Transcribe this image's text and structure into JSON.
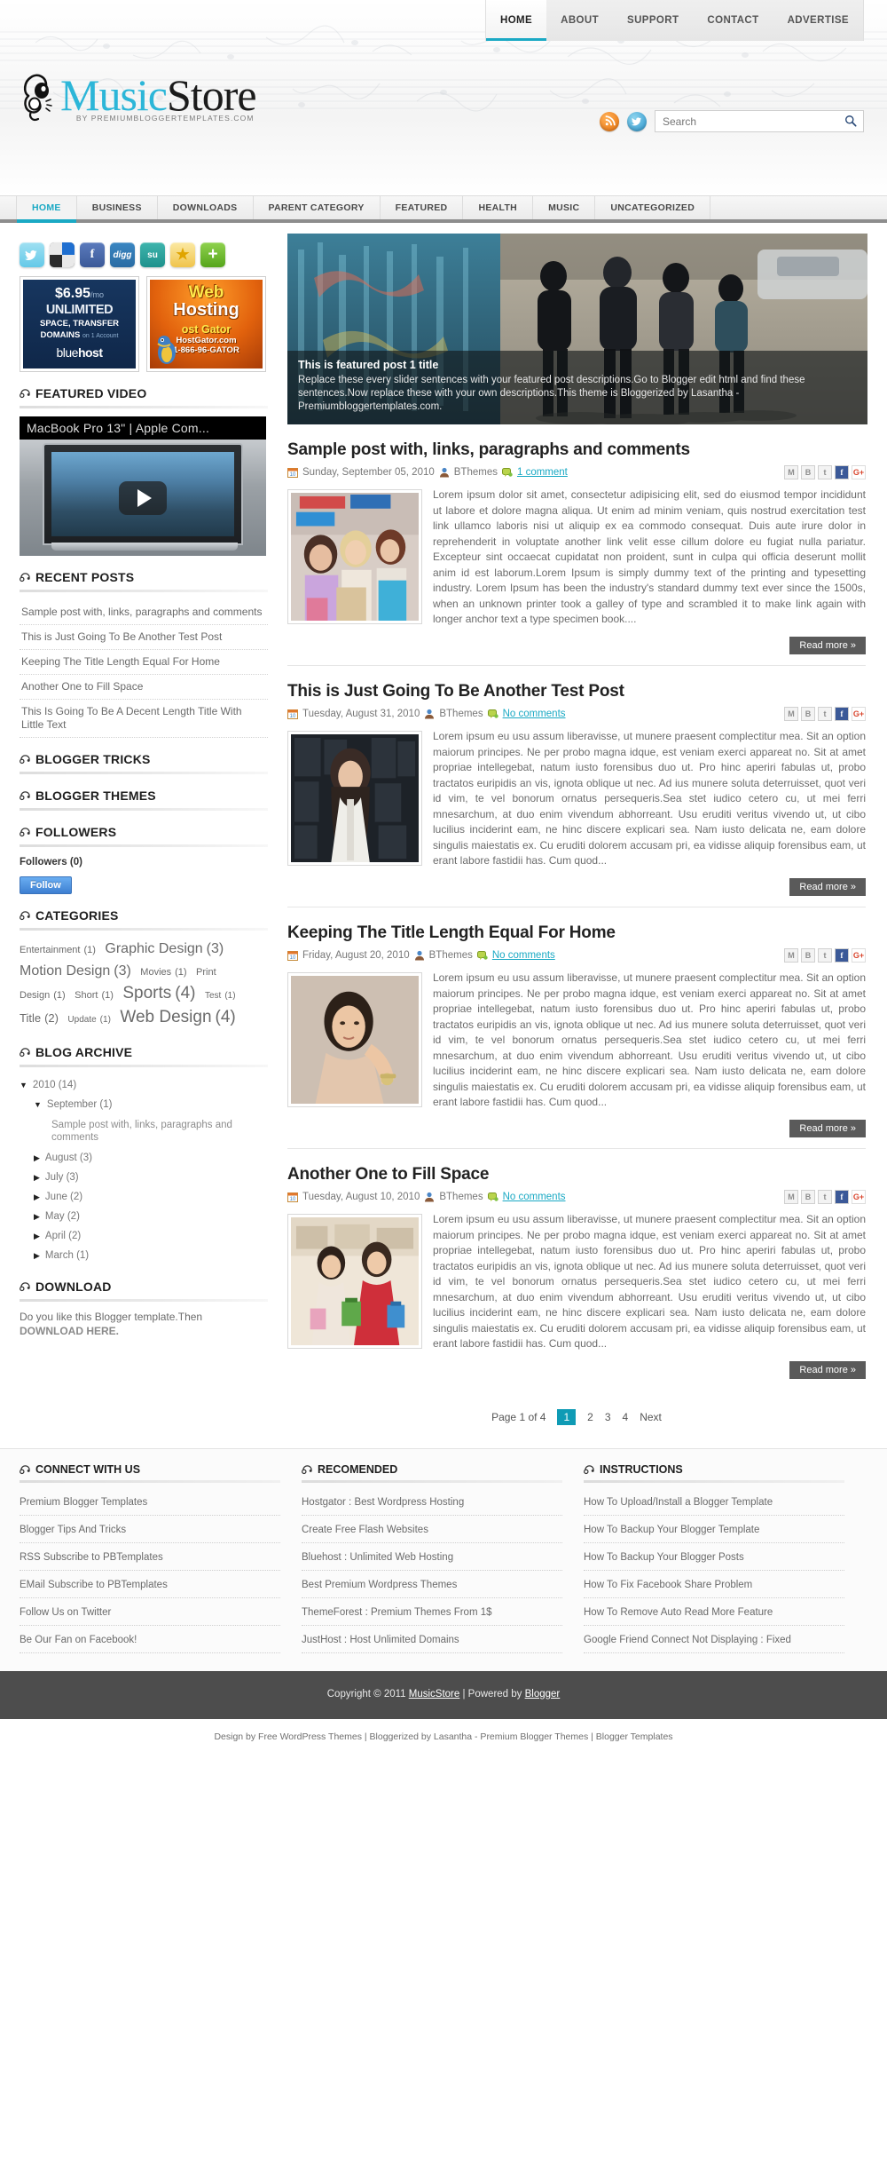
{
  "header": {
    "top_nav": [
      {
        "label": "HOME",
        "active": true
      },
      {
        "label": "ABOUT",
        "active": false
      },
      {
        "label": "SUPPORT",
        "active": false
      },
      {
        "label": "CONTACT",
        "active": false
      },
      {
        "label": "ADVERTISE",
        "active": false
      }
    ],
    "logo_part1": "Music",
    "logo_part2": "Store",
    "logo_sub": "BY PREMIUMBLOGGERTEMPLATES.COM",
    "search_placeholder": "Search",
    "search_value": ""
  },
  "main_nav": [
    {
      "label": "HOME",
      "active": true
    },
    {
      "label": "BUSINESS",
      "active": false
    },
    {
      "label": "DOWNLOADS",
      "active": false
    },
    {
      "label": "PARENT CATEGORY",
      "active": false
    },
    {
      "label": "FEATURED",
      "active": false
    },
    {
      "label": "HEALTH",
      "active": false
    },
    {
      "label": "MUSIC",
      "active": false
    },
    {
      "label": "UNCATEGORIZED",
      "active": false
    }
  ],
  "sidebar": {
    "social_buttons": [
      {
        "name": "twitter",
        "glyph": "t"
      },
      {
        "name": "delicious",
        "glyph": ""
      },
      {
        "name": "facebook",
        "glyph": "f"
      },
      {
        "name": "digg",
        "glyph": "digg"
      },
      {
        "name": "stumbleupon",
        "glyph": "su"
      },
      {
        "name": "favorite",
        "glyph": "★"
      },
      {
        "name": "share-more",
        "glyph": "+"
      }
    ],
    "ads": {
      "bluehost": {
        "price": "$6.95",
        "per": "/mo",
        "line1": "UNLIMITED",
        "line2": "SPACE, TRANSFER",
        "line3": "DOMAINS",
        "line3_small": "on 1 Account",
        "brand_light": "blue",
        "brand_bold": "host"
      },
      "hostgator": {
        "line1": "Web",
        "line2": "Hosting",
        "line3": "ost Gator",
        "line4": "HostGator.com",
        "line5": "1-866-96-GATOR"
      }
    },
    "featured_video": {
      "title": "FEATURED VIDEO",
      "video_title": "MacBook Pro 13\" | Apple Com..."
    },
    "recent_posts": {
      "title": "RECENT POSTS",
      "items": [
        "Sample post with, links, paragraphs and comments",
        "This is Just Going To Be Another Test Post",
        "Keeping The Title Length Equal For Home",
        "Another One to Fill Space",
        "This Is Going To Be A Decent Length Title With Little Text"
      ]
    },
    "blogger_tricks_title": "BLOGGER TRICKS",
    "blogger_themes_title": "BLOGGER THEMES",
    "followers": {
      "title": "FOLLOWERS",
      "label": "Followers (0)",
      "button": "Follow"
    },
    "categories": {
      "title": "CATEGORIES",
      "items": [
        {
          "name": "Entertainment",
          "count": "(1)",
          "size": 11
        },
        {
          "name": "Graphic Design",
          "count": "(3)",
          "size": 16
        },
        {
          "name": "Motion Design",
          "count": "(3)",
          "size": 16
        },
        {
          "name": "Movies",
          "count": "(1)",
          "size": 11
        },
        {
          "name": "Print Design",
          "count": "(1)",
          "size": 11
        },
        {
          "name": "Short",
          "count": "(1)",
          "size": 11
        },
        {
          "name": "Sports",
          "count": "(4)",
          "size": 19
        },
        {
          "name": "Test",
          "count": "(1)",
          "size": 10
        },
        {
          "name": "Title",
          "count": "(2)",
          "size": 13
        },
        {
          "name": "Update",
          "count": "(1)",
          "size": 10
        },
        {
          "name": "Web Design",
          "count": "(4)",
          "size": 19
        }
      ]
    },
    "blog_archive": {
      "title": "BLOG ARCHIVE",
      "year": {
        "arrow": "▼",
        "label": "2010 (14)"
      },
      "month_open": {
        "arrow": "▼",
        "label": "September (1)"
      },
      "month_post": "Sample post with, links, paragraphs and comments",
      "months": [
        {
          "arrow": "▶",
          "label": "August (3)"
        },
        {
          "arrow": "▶",
          "label": "July (3)"
        },
        {
          "arrow": "▶",
          "label": "June (2)"
        },
        {
          "arrow": "▶",
          "label": "May (2)"
        },
        {
          "arrow": "▶",
          "label": "April (2)"
        },
        {
          "arrow": "▶",
          "label": "March (1)"
        }
      ]
    },
    "download": {
      "title": "DOWNLOAD",
      "text": "Do you like this Blogger template.Then ",
      "link": "DOWNLOAD HERE."
    }
  },
  "slider": {
    "title": "This is featured post 1 title",
    "description": "Replace these every slider sentences with your featured post descriptions.Go to Blogger edit html and find these sentences.Now replace these with your own descriptions.This theme is Bloggerized by Lasantha - Premiumbloggertemplates.com."
  },
  "share_icons": [
    {
      "name": "gmail-share-icon",
      "glyph": "M"
    },
    {
      "name": "blogger-share-icon",
      "glyph": "B"
    },
    {
      "name": "twitter-share-icon",
      "glyph": "t"
    },
    {
      "name": "facebook-share-icon",
      "glyph": "f"
    },
    {
      "name": "google-plus-share-icon",
      "glyph": "G+"
    }
  ],
  "posts": [
    {
      "title": "Sample post with, links, paragraphs and comments",
      "date": "Sunday, September 05, 2010",
      "author": "BThemes",
      "comments": "1 comment",
      "body": "Lorem ipsum dolor sit amet, consectetur adipisicing elit, sed do eiusmod tempor incididunt ut labore et dolore magna aliqua. Ut enim ad minim veniam, quis nostrud exercitation test link ullamco laboris nisi ut aliquip ex ea commodo consequat. Duis aute irure dolor in reprehenderit in voluptate another link velit esse cillum dolore eu fugiat nulla pariatur. Excepteur sint occaecat cupidatat non proident, sunt in culpa qui officia deserunt mollit anim id est laborum.Lorem Ipsum is simply dummy text of the printing and typesetting industry. Lorem Ipsum has been the industry's standard dummy text ever since the 1500s, when an unknown printer took a galley of type and scrambled it to make link again with longer anchor text a type specimen book....",
      "readmore": "Read more »",
      "thumb": "shopping-girls"
    },
    {
      "title": "This is Just Going To Be Another Test Post",
      "date": "Tuesday, August 31, 2010",
      "author": "BThemes",
      "comments": "No comments",
      "body": "Lorem ipsum eu usu assum liberavisse, ut munere praesent complectitur mea. Sit an option maiorum principes. Ne per probo magna idque, est veniam exerci appareat no. Sit at amet propriae intellegebat, natum iusto forensibus duo ut. Pro hinc aperiri fabulas ut, probo tractatos euripidis an vis, ignota oblique ut nec. Ad ius munere soluta deterruisset, quot veri id vim, te vel bonorum ornatus persequeris.Sea stet iudico cetero cu, ut mei ferri mnesarchum, at duo enim vivendum abhorreant. Usu eruditi veritus vivendo ut, ut cibo lucilius inciderint eam, ne hinc discere explicari sea. Nam iusto delicata ne, eam dolore singulis maiestatis ex. Cu eruditi dolorem accusam pri, ea vidisse aliquip forensibus eam, ut erant labore fastidii has. Cum quod...",
      "readmore": "Read more »",
      "thumb": "dark-portrait"
    },
    {
      "title": "Keeping The Title Length Equal For Home",
      "date": "Friday, August 20, 2010",
      "author": "BThemes",
      "comments": "No comments",
      "body": "Lorem ipsum eu usu assum liberavisse, ut munere praesent complectitur mea. Sit an option maiorum principes. Ne per probo magna idque, est veniam exerci appareat no. Sit at amet propriae intellegebat, natum iusto forensibus duo ut. Pro hinc aperiri fabulas ut, probo tractatos euripidis an vis, ignota oblique ut nec. Ad ius munere soluta deterruisset, quot veri id vim, te vel bonorum ornatus persequeris.Sea stet iudico cetero cu, ut mei ferri mnesarchum, at duo enim vivendum abhorreant. Usu eruditi veritus vivendo ut, ut cibo lucilius inciderint eam, ne hinc discere explicari sea. Nam iusto delicata ne, eam dolore singulis maiestatis ex. Cu eruditi dolorem accusam pri, ea vidisse aliquip forensibus eam, ut erant labore fastidii has. Cum quod...",
      "readmore": "Read more »",
      "thumb": "woman-jewelry"
    },
    {
      "title": "Another One to Fill Space",
      "date": "Tuesday, August 10, 2010",
      "author": "BThemes",
      "comments": "No comments",
      "body": "Lorem ipsum eu usu assum liberavisse, ut munere praesent complectitur mea. Sit an option maiorum principes. Ne per probo magna idque, est veniam exerci appareat no. Sit at amet propriae intellegebat, natum iusto forensibus duo ut. Pro hinc aperiri fabulas ut, probo tractatos euripidis an vis, ignota oblique ut nec. Ad ius munere soluta deterruisset, quot veri id vim, te vel bonorum ornatus persequeris.Sea stet iudico cetero cu, ut mei ferri mnesarchum, at duo enim vivendum abhorreant. Usu eruditi veritus vivendo ut, ut cibo lucilius inciderint eam, ne hinc discere explicari sea. Nam iusto delicata ne, eam dolore singulis maiestatis ex. Cu eruditi dolorem accusam pri, ea vidisse aliquip forensibus eam, ut erant labore fastidii has. Cum quod...",
      "readmore": "Read more »",
      "thumb": "red-dress-shopper"
    }
  ],
  "pagination": {
    "label": "Page 1 of 4",
    "pages": [
      "1",
      "2",
      "3",
      "4"
    ],
    "current": "1",
    "next": "Next"
  },
  "footer": {
    "columns": [
      {
        "title": "CONNECT WITH US",
        "links": [
          "Premium Blogger Templates",
          "Blogger Tips And Tricks",
          "RSS Subscribe to PBTemplates",
          "EMail Subscribe to PBTemplates",
          "Follow Us on Twitter",
          "Be Our Fan on Facebook!"
        ]
      },
      {
        "title": "RECOMENDED",
        "links": [
          "Hostgator : Best Wordpress Hosting",
          "Create Free Flash Websites",
          "Bluehost : Unlimited Web Hosting",
          "Best Premium Wordpress Themes",
          "ThemeForest : Premium Themes From 1$",
          "JustHost : Host Unlimited Domains"
        ]
      },
      {
        "title": "INSTRUCTIONS",
        "links": [
          "How To Upload/Install a Blogger Template",
          "How To Backup Your Blogger Template",
          "How To Backup Your Blogger Posts",
          "How To Fix Facebook Share Problem",
          "How To Remove Auto Read More Feature",
          "Google Friend Connect Not Displaying : Fixed"
        ]
      }
    ],
    "copyright_prefix": "Copyright © 2011 ",
    "copyright_site": "MusicStore",
    "copyright_mid": " | Powered by ",
    "copyright_platform": "Blogger",
    "credit": "Design by Free WordPress Themes | Bloggerized by Lasantha - Premium Blogger Themes | Blogger Templates"
  },
  "colors": {
    "accent": "#1aa9c4",
    "logo_cyan": "#2cb6d8",
    "footer_bar": "#4d4d4d",
    "pager_active": "#0f9bb5"
  }
}
